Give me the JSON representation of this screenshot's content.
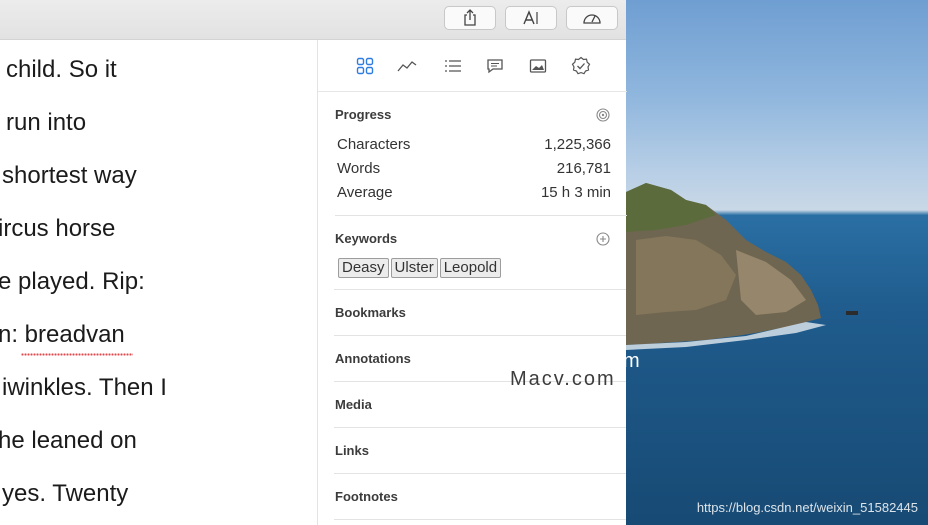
{
  "editor": {
    "lines": [
      "child. So it",
      "run into",
      "shortest way",
      "ircus horse",
      "e played. Rip:",
      "n: breadvan",
      "iwinkles. Then I",
      "he leaned on",
      "yes. Twenty"
    ]
  },
  "sidebar": {
    "tabs": [
      "grid-icon",
      "chart-line-icon",
      "list-icon",
      "comment-icon",
      "image-icon",
      "check-badge-icon"
    ],
    "progress": {
      "title": "Progress",
      "rows": [
        {
          "label": "Characters",
          "value": "1,225,366"
        },
        {
          "label": "Words",
          "value": "216,781"
        },
        {
          "label": "Average",
          "value": "15 h 3 min"
        }
      ]
    },
    "keywords": {
      "title": "Keywords",
      "items": [
        "Deasy",
        "Ulster",
        "Leopold"
      ]
    },
    "sections": [
      "Bookmarks",
      "Annotations",
      "Media",
      "Links",
      "Footnotes"
    ]
  },
  "watermark": {
    "site": "Macv.com",
    "partial": "m",
    "url": "https://blog.csdn.net/weixin_51582445"
  },
  "colors": {
    "spell_error": "#e2474b",
    "sea": "#1f5b8c",
    "sky": "#8fb6dd"
  }
}
